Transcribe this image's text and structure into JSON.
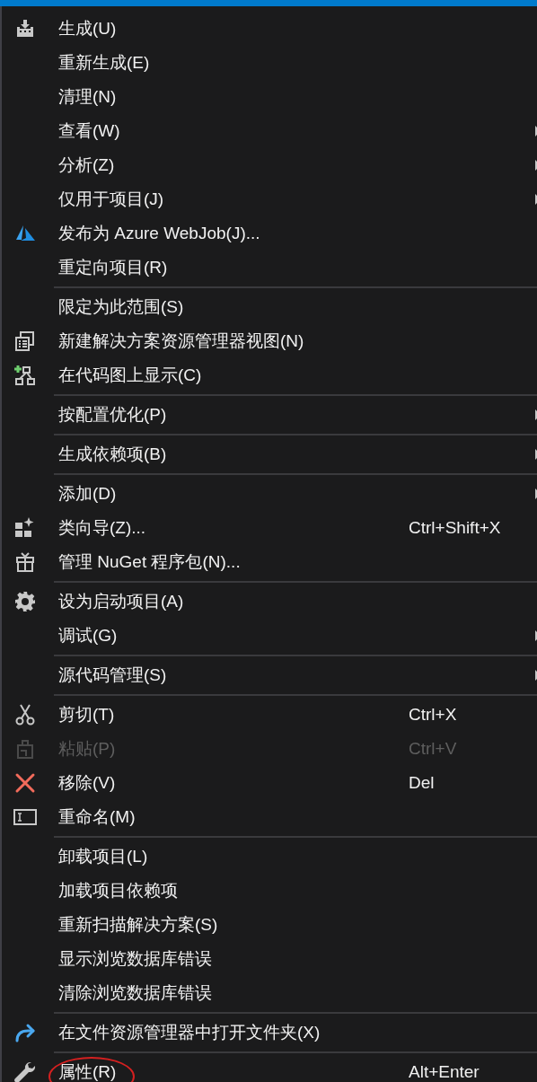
{
  "groups": [
    [
      {
        "kind": "build",
        "label": "生成(U)",
        "submenu": false,
        "disabled": false
      },
      {
        "label": "重新生成(E)",
        "submenu": false,
        "disabled": false
      },
      {
        "label": "清理(N)",
        "submenu": false,
        "disabled": false
      },
      {
        "label": "查看(W)",
        "submenu": true,
        "disabled": false
      },
      {
        "label": "分析(Z)",
        "submenu": true,
        "disabled": false
      },
      {
        "label": "仅用于项目(J)",
        "submenu": true,
        "disabled": false
      },
      {
        "kind": "azure",
        "label": "发布为 Azure WebJob(J)...",
        "submenu": false,
        "disabled": false
      },
      {
        "label": "重定向项目(R)",
        "submenu": false,
        "disabled": false
      }
    ],
    [
      {
        "label": "限定为此范围(S)",
        "submenu": false,
        "disabled": false
      },
      {
        "kind": "view",
        "label": "新建解决方案资源管理器视图(N)",
        "submenu": false,
        "disabled": false
      },
      {
        "kind": "codemap",
        "label": "在代码图上显示(C)",
        "submenu": false,
        "disabled": false
      }
    ],
    [
      {
        "label": "按配置优化(P)",
        "submenu": true,
        "disabled": false
      }
    ],
    [
      {
        "label": "生成依赖项(B)",
        "submenu": true,
        "disabled": false
      }
    ],
    [
      {
        "label": "添加(D)",
        "submenu": true,
        "disabled": false
      },
      {
        "kind": "wizard",
        "label": "类向导(Z)...",
        "shortcut": "Ctrl+Shift+X",
        "submenu": false,
        "disabled": false
      },
      {
        "kind": "package",
        "label": "管理 NuGet 程序包(N)...",
        "submenu": false,
        "disabled": false
      }
    ],
    [
      {
        "kind": "gear",
        "label": "设为启动项目(A)",
        "submenu": false,
        "disabled": false
      },
      {
        "label": "调试(G)",
        "submenu": true,
        "disabled": false
      }
    ],
    [
      {
        "label": "源代码管理(S)",
        "submenu": true,
        "disabled": false
      }
    ],
    [
      {
        "kind": "scissors",
        "label": "剪切(T)",
        "shortcut": "Ctrl+X",
        "submenu": false,
        "disabled": false
      },
      {
        "kind": "paste",
        "label": "粘贴(P)",
        "shortcut": "Ctrl+V",
        "submenu": false,
        "disabled": true
      },
      {
        "kind": "remove",
        "label": "移除(V)",
        "shortcut": "Del",
        "submenu": false,
        "disabled": false
      },
      {
        "kind": "rename",
        "label": "重命名(M)",
        "submenu": false,
        "disabled": false
      }
    ],
    [
      {
        "label": "卸载项目(L)",
        "submenu": false,
        "disabled": false
      },
      {
        "label": "加载项目依赖项",
        "submenu": false,
        "disabled": false
      },
      {
        "label": "重新扫描解决方案(S)",
        "submenu": false,
        "disabled": false
      },
      {
        "label": "显示浏览数据库错误",
        "submenu": false,
        "disabled": false
      },
      {
        "label": "清除浏览数据库错误",
        "submenu": false,
        "disabled": false
      }
    ],
    [
      {
        "kind": "folder",
        "label": "在文件资源管理器中打开文件夹(X)",
        "submenu": false,
        "disabled": false
      }
    ],
    [
      {
        "kind": "wrench",
        "label": "属性(R)",
        "shortcut": "Alt+Enter",
        "submenu": false,
        "disabled": false,
        "circled": true
      }
    ]
  ]
}
